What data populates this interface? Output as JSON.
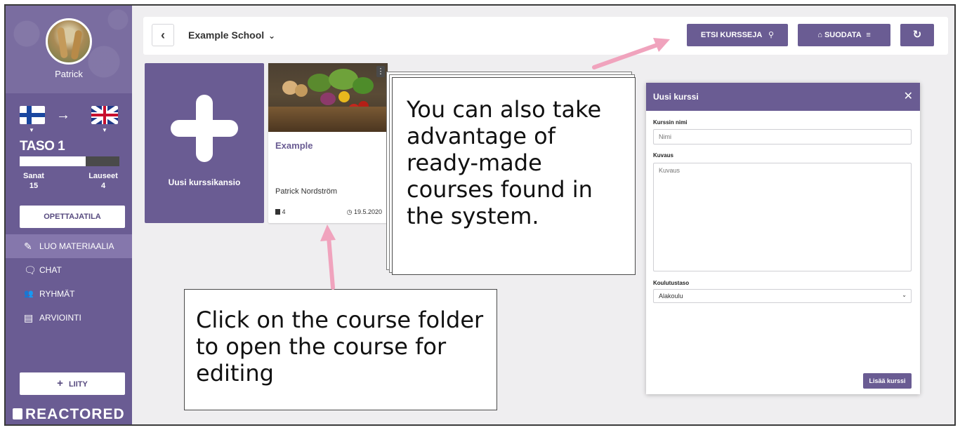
{
  "sidebar": {
    "username": "Patrick",
    "arrow": "→",
    "level_label": "TASO 1",
    "level_progress": 0.66,
    "stats": [
      {
        "label": "Sanat",
        "value": "15"
      },
      {
        "label": "Lauseet",
        "value": "4"
      }
    ],
    "teacher_mode_label": "OPETTAJATILA",
    "menu": [
      {
        "icon": "pencil-icon",
        "glyph": "✎",
        "label": "LUO MATERIAALIA"
      },
      {
        "icon": "chat-icon",
        "glyph": "🗨",
        "label": "CHAT"
      },
      {
        "icon": "group-icon",
        "glyph": "👥",
        "label": "RYHMÄT"
      },
      {
        "icon": "id-card-icon",
        "glyph": "▤",
        "label": "ARVIOINTI"
      }
    ],
    "join_label": "LIITY",
    "join_glyph": "+",
    "brand": "REACTORED"
  },
  "header": {
    "back_glyph": "‹",
    "school": "Example School",
    "school_caret": "⌄",
    "search_label": "ETSI KURSSEJA",
    "filter_label": "SUODATA",
    "refresh_glyph": "↻"
  },
  "new_course_card": {
    "label": "Uusi kurssikansio"
  },
  "course_card": {
    "title": "Example",
    "author": "Patrick Nordström",
    "count": "4",
    "date": "19.5.2020",
    "menu_glyph": "⋮"
  },
  "callouts": {
    "ready_made": "You can also take advantage of ready-made courses found in the system.",
    "click_folder": "Click on the course folder to open the course for editing"
  },
  "dialog": {
    "title": "Uusi kurssi",
    "close_glyph": "✕",
    "name_label": "Kurssin nimi",
    "name_placeholder": "Nimi",
    "desc_label": "Kuvaus",
    "desc_placeholder": "Kuvaus",
    "level_label": "Koulutustaso",
    "level_value": "Alakoulu",
    "submit_label": "Lisää kurssi"
  },
  "colors": {
    "accent": "#6a5c93",
    "annotation_arrow": "#f0a3bd"
  }
}
